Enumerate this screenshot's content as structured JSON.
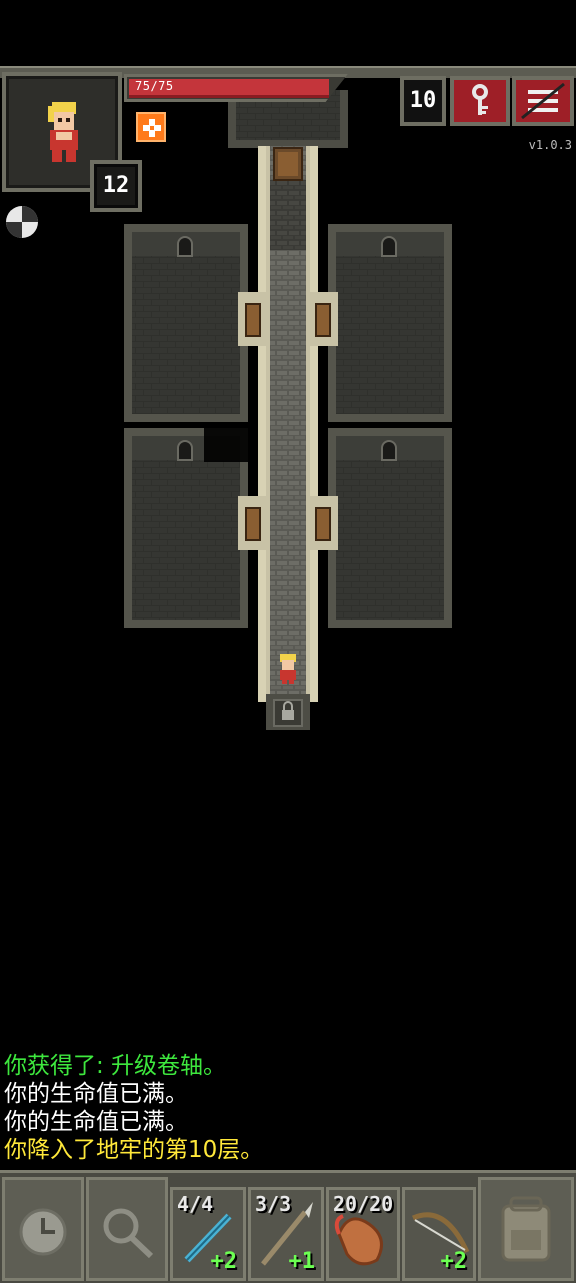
{
  "hud": {
    "hp_text": "75/75",
    "hp_fraction": 1.0,
    "hero_level": "12",
    "depth": "10",
    "version": "v1.0.3",
    "buff_icon": "buff-icon",
    "key_icon": "iron-key-icon",
    "menu_icon": "menu-icon",
    "compass_icon": "compass-icon"
  },
  "log": [
    {
      "text": "你获得了: 升级卷轴。",
      "color": "#3ee83e"
    },
    {
      "text": "你的生命值已满。",
      "color": "#ffffff"
    },
    {
      "text": "你的生命值已满。",
      "color": "#ffffff"
    },
    {
      "text": "你降入了地牢的第10层。",
      "color": "#ffe83a"
    }
  ],
  "toolbar": {
    "wait_icon": "clock-icon",
    "search_icon": "magnifier-icon",
    "slots": [
      {
        "count": "4/4",
        "level": "+2",
        "icon": "wand-icon"
      },
      {
        "count": "3/3",
        "level": "+1",
        "icon": "throwing-spear-icon"
      },
      {
        "count": "20/20",
        "level": "",
        "icon": "horn-icon"
      },
      {
        "count": "",
        "level": "+2",
        "icon": "bow-icon"
      }
    ],
    "backpack_icon": "backpack-icon"
  },
  "colors": {
    "hp": "#c4353b",
    "menu_button": "#9e1f27",
    "ui_frame": "#6e6e62",
    "upgrade_text": "#6cff52"
  }
}
